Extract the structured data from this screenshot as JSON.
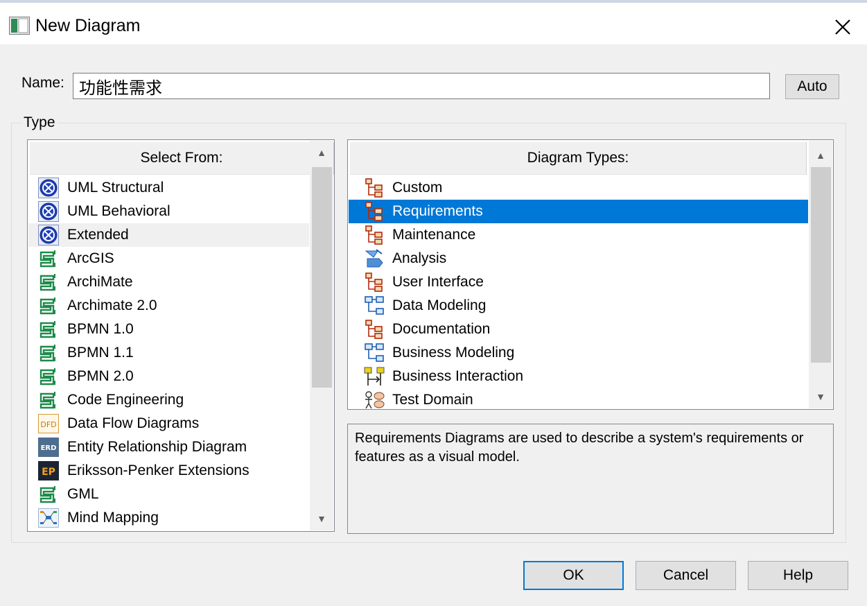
{
  "window": {
    "title": "New Diagram",
    "icon": "window-app-icon",
    "close_icon": "close-icon"
  },
  "name_field": {
    "label": "Name:",
    "value": "功能性需求"
  },
  "auto_button": "Auto",
  "type_group": {
    "legend": "Type"
  },
  "select_from": {
    "header": "Select From:",
    "items": [
      {
        "label": "UML Structural",
        "icon": "uml-icon"
      },
      {
        "label": "UML Behavioral",
        "icon": "uml-icon"
      },
      {
        "label": "Extended",
        "icon": "uml-icon",
        "hover": true
      },
      {
        "label": "ArcGIS",
        "icon": "mdg-icon"
      },
      {
        "label": "ArchiMate",
        "icon": "mdg-icon"
      },
      {
        "label": "Archimate 2.0",
        "icon": "mdg-icon"
      },
      {
        "label": "BPMN 1.0",
        "icon": "mdg-icon"
      },
      {
        "label": "BPMN 1.1",
        "icon": "mdg-icon"
      },
      {
        "label": "BPMN 2.0",
        "icon": "mdg-icon"
      },
      {
        "label": "Code Engineering",
        "icon": "mdg-icon"
      },
      {
        "label": "Data Flow Diagrams",
        "icon": "dfd-icon"
      },
      {
        "label": "Entity Relationship Diagram",
        "icon": "erd-icon"
      },
      {
        "label": "Eriksson-Penker Extensions",
        "icon": "ep-icon"
      },
      {
        "label": "GML",
        "icon": "mdg-icon"
      },
      {
        "label": "Mind Mapping",
        "icon": "mindmap-icon"
      }
    ]
  },
  "diagram_types": {
    "header": "Diagram Types:",
    "selected": "Requirements",
    "items": [
      {
        "label": "Custom",
        "icon": "custom-diagram-icon"
      },
      {
        "label": "Requirements",
        "icon": "requirements-diagram-icon"
      },
      {
        "label": "Maintenance",
        "icon": "maintenance-diagram-icon"
      },
      {
        "label": "Analysis",
        "icon": "analysis-diagram-icon"
      },
      {
        "label": "User Interface",
        "icon": "user-interface-diagram-icon"
      },
      {
        "label": "Data Modeling",
        "icon": "data-modeling-diagram-icon"
      },
      {
        "label": "Documentation",
        "icon": "documentation-diagram-icon"
      },
      {
        "label": "Business Modeling",
        "icon": "business-modeling-diagram-icon"
      },
      {
        "label": "Business Interaction",
        "icon": "business-interaction-diagram-icon"
      },
      {
        "label": "Test Domain",
        "icon": "test-domain-diagram-icon"
      }
    ]
  },
  "description": "Requirements Diagrams are used to describe a system's requirements or features as a visual model.",
  "buttons": {
    "ok": "OK",
    "cancel": "Cancel",
    "help": "Help"
  },
  "colors": {
    "selection": "#0078d7",
    "dialog_bg": "#f0f0f0",
    "button_face": "#e1e1e1"
  }
}
